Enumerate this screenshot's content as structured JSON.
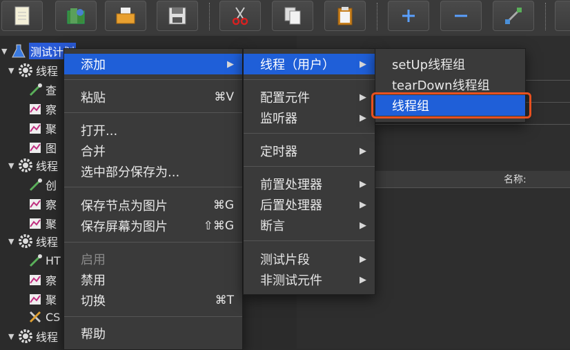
{
  "tree": {
    "root_label": "测试计划",
    "items": [
      {
        "label": "线程"
      },
      {
        "label": "查"
      },
      {
        "label": "察"
      },
      {
        "label": "聚"
      },
      {
        "label": "图"
      },
      {
        "label": "线程"
      },
      {
        "label": "创"
      },
      {
        "label": "察"
      },
      {
        "label": "聚"
      },
      {
        "label": "线程"
      },
      {
        "label": "HT"
      },
      {
        "label": "察"
      },
      {
        "label": "聚"
      },
      {
        "label": "CS"
      },
      {
        "label": "线程"
      }
    ]
  },
  "panel": {
    "name_label": "名称:"
  },
  "context_menu": {
    "add": "添加",
    "paste": "粘贴",
    "paste_shortcut": "⌘V",
    "open": "打开...",
    "merge": "合并",
    "save_selection_as": "选中部分保存为...",
    "save_node_image": "保存节点为图片",
    "save_node_image_shortcut": "⌘G",
    "save_screen_image": "保存屏幕为图片",
    "save_screen_image_shortcut": "⇧⌘G",
    "enable": "启用",
    "disable": "禁用",
    "toggle": "切换",
    "toggle_shortcut": "⌘T",
    "help": "帮助"
  },
  "add_menu": {
    "threads_users": "线程（用户）",
    "config_element": "配置元件",
    "listener": "监听器",
    "timer": "定时器",
    "pre_processor": "前置处理器",
    "post_processor": "后置处理器",
    "assertion": "断言",
    "test_fragment": "测试片段",
    "non_test_elements": "非测试元件"
  },
  "threads_menu": {
    "setup_thread_group": "setUp线程组",
    "teardown_thread_group": "tearDown线程组",
    "thread_group": "线程组"
  },
  "colors": {
    "highlight": "#1f5fd8",
    "annotation_border": "#e8501f",
    "selection": "#2a5bd7"
  }
}
